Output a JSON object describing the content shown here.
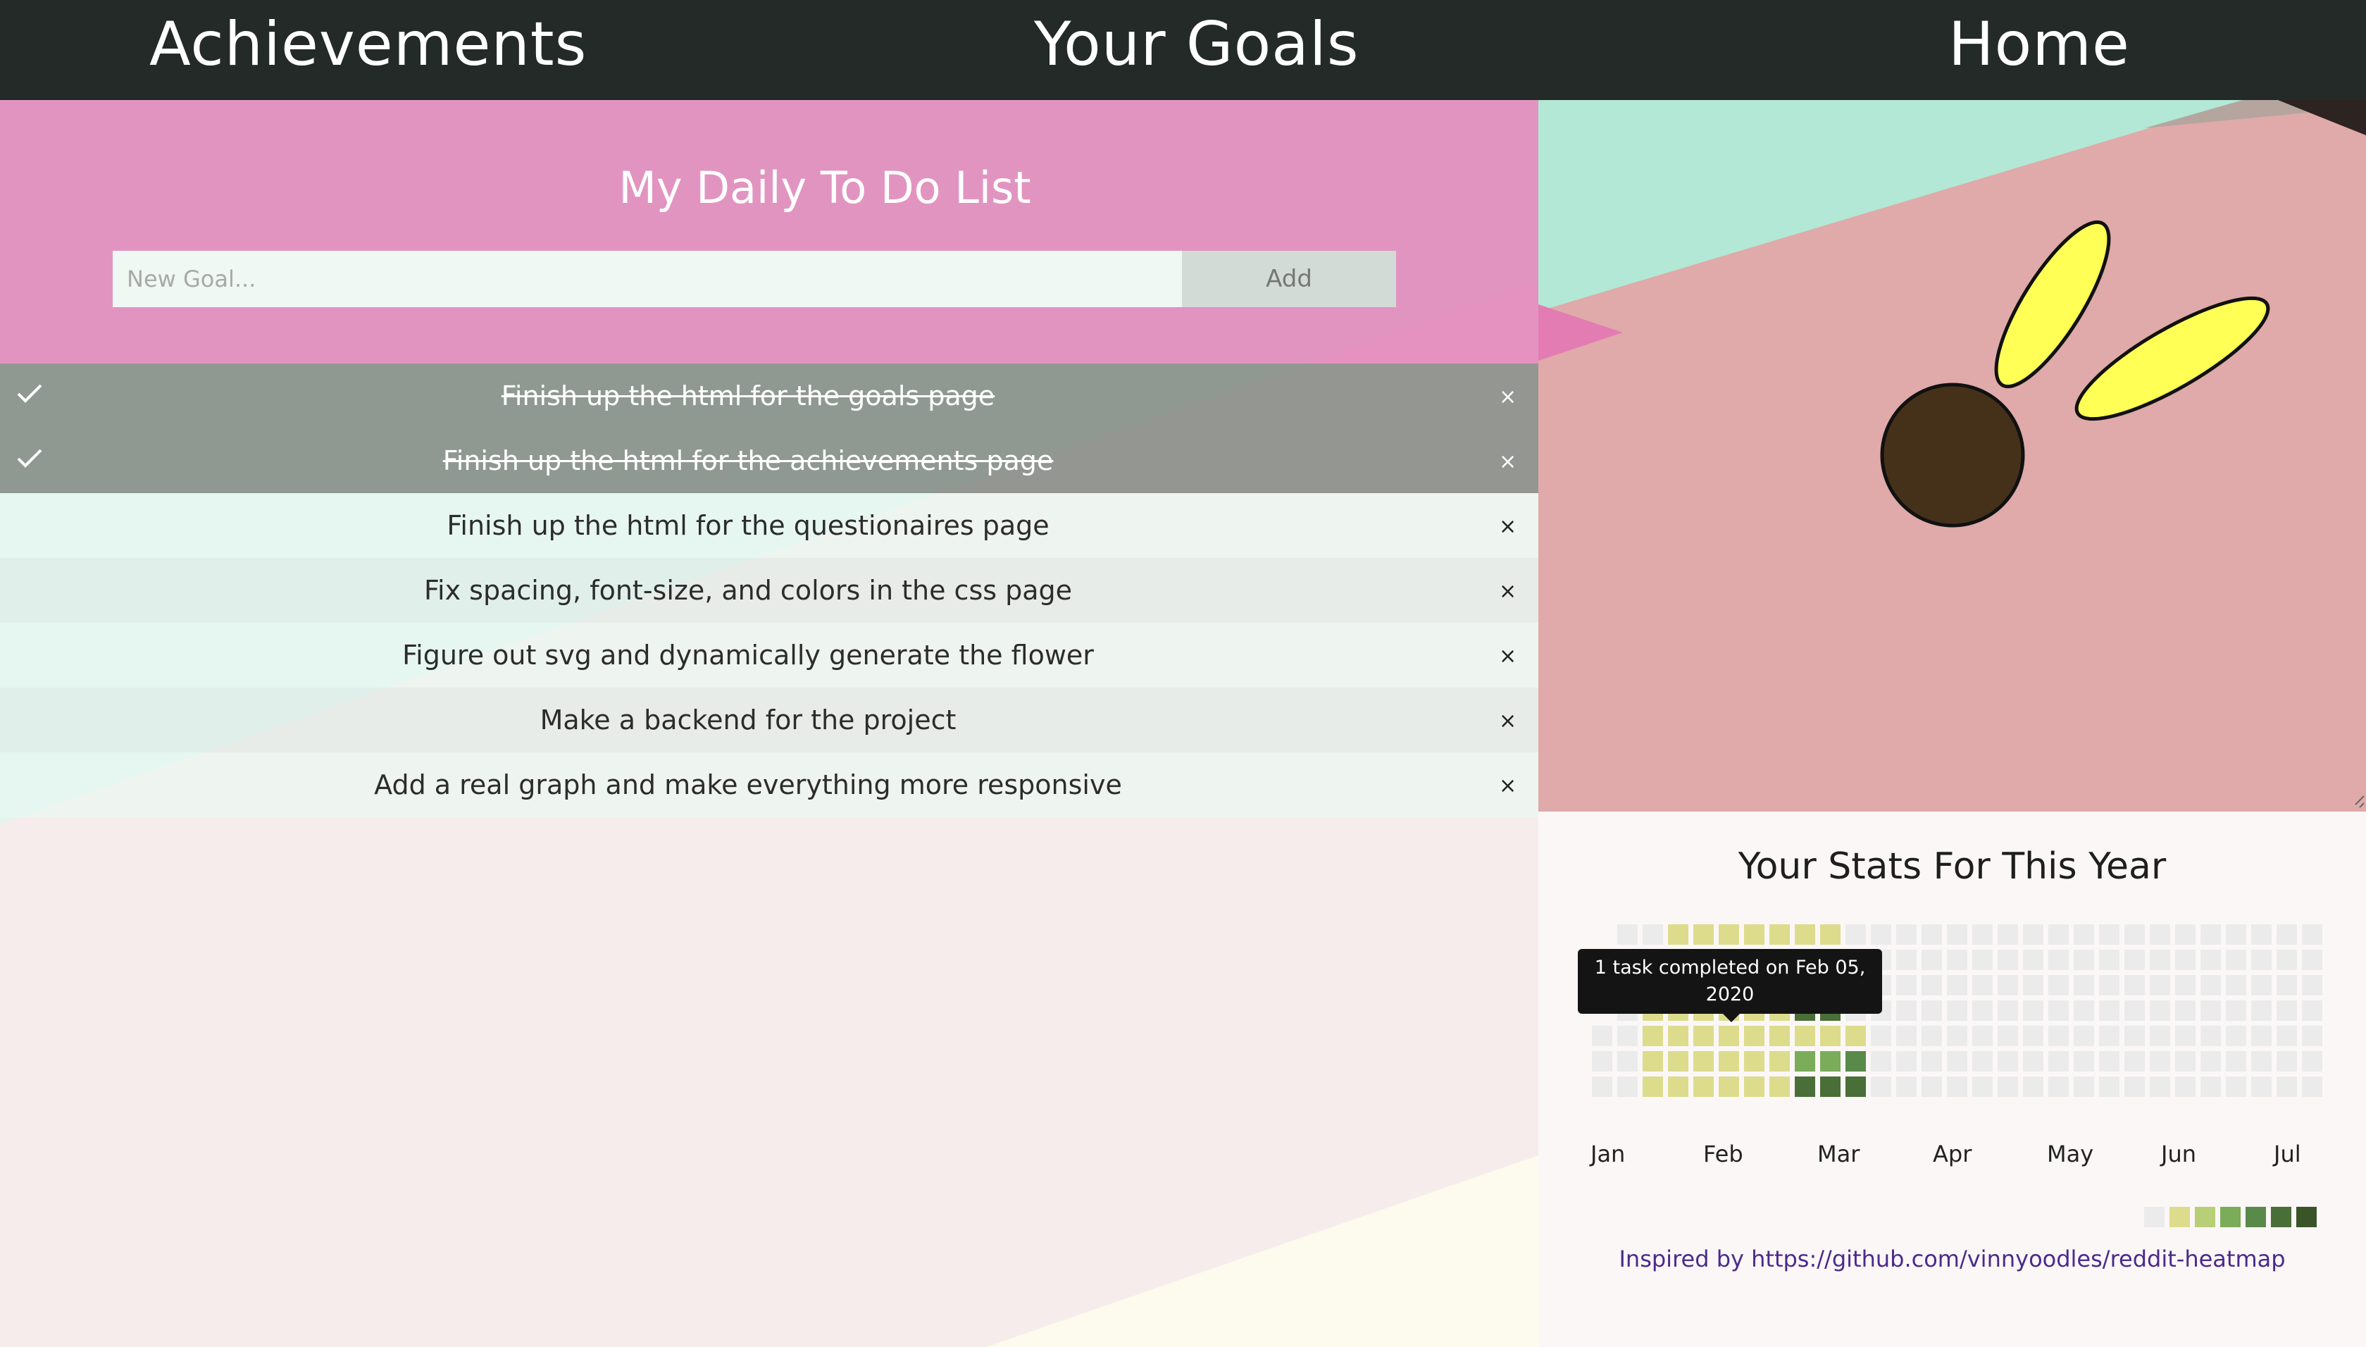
{
  "nav": {
    "achievements_label": "Achievements",
    "goals_label": "Your Goals",
    "home_label": "Home"
  },
  "todo": {
    "title": "My Daily To Do List",
    "input_placeholder": "New Goal...",
    "add_label": "Add",
    "tasks": [
      {
        "text": "Finish up the html for the goals page",
        "done": true
      },
      {
        "text": "Finish up the html for the achievements page",
        "done": true
      },
      {
        "text": "Finish up the html for the questionaires page",
        "done": false
      },
      {
        "text": "Fix spacing, font-size, and colors in the css page",
        "done": false
      },
      {
        "text": "Figure out svg and dynamically generate the flower",
        "done": false
      },
      {
        "text": "Make a backend for the project",
        "done": false
      },
      {
        "text": "Add a real graph and make everything more responsive",
        "done": false
      }
    ],
    "close_glyph": "×"
  },
  "stats": {
    "title": "Your Stats For This Year",
    "tooltip": "1 task completed on Feb 05, 2020",
    "months": [
      "Jan",
      "Feb",
      "Mar",
      "Apr",
      "May",
      "Jun",
      "Jul"
    ],
    "credit": "Inspired by https://github.com/vinnyoodles/reddit-heatmap"
  },
  "colors": {
    "nav_bg": "#232a27",
    "pink_header": "#e179b4",
    "checked_row": "#808680",
    "heat_empty": "#ebebeb",
    "heat_1": "#dcdc8c",
    "heat_2": "#b8cf78",
    "heat_3": "#7aac5a",
    "heat_4": "#5a8a4a",
    "heat_5": "#4a6e38",
    "heat_6": "#3a5428",
    "petal": "#ffff55",
    "flower_center": "#45311a",
    "link": "#4b2a8c"
  }
}
